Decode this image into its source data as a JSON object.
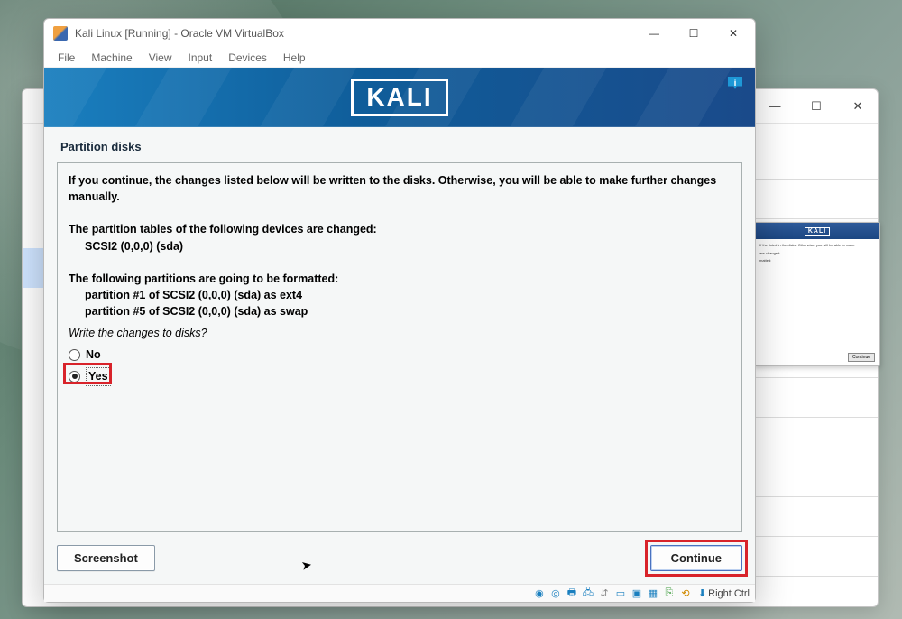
{
  "bg_window": {
    "min": "—",
    "max": "☐",
    "close": "✕"
  },
  "mini": {
    "logo": "KALI",
    "line1": "If the listed in the disks. Otherwise, you will be able to make",
    "line2": "are changed:",
    "line3": "matted:",
    "btn": "Continue"
  },
  "title": "Kali Linux [Running] - Oracle VM VirtualBox",
  "winbtns": {
    "min": "—",
    "max": "☐",
    "close": "✕"
  },
  "menu": {
    "file": "File",
    "machine": "Machine",
    "view": "View",
    "input": "Input",
    "devices": "Devices",
    "help": "Help"
  },
  "kali": {
    "logo": "KALI",
    "info": "i"
  },
  "step_title": "Partition disks",
  "text": {
    "l1": "If you continue, the changes listed below will be written to the disks. Otherwise, you will be able to make further changes manually.",
    "l2": "The partition tables of the following devices are changed:",
    "l2a": "SCSI2 (0,0,0) (sda)",
    "l3": "The following partitions are going to be formatted:",
    "l3a": "partition #1 of SCSI2 (0,0,0) (sda) as ext4",
    "l3b": "partition #5 of SCSI2 (0,0,0) (sda) as swap",
    "prompt": "Write the changes to disks?"
  },
  "options": {
    "no": "No",
    "yes": "Yes"
  },
  "buttons": {
    "screenshot": "Screenshot",
    "continue": "Continue"
  },
  "status": {
    "hostkey": "Right Ctrl"
  }
}
